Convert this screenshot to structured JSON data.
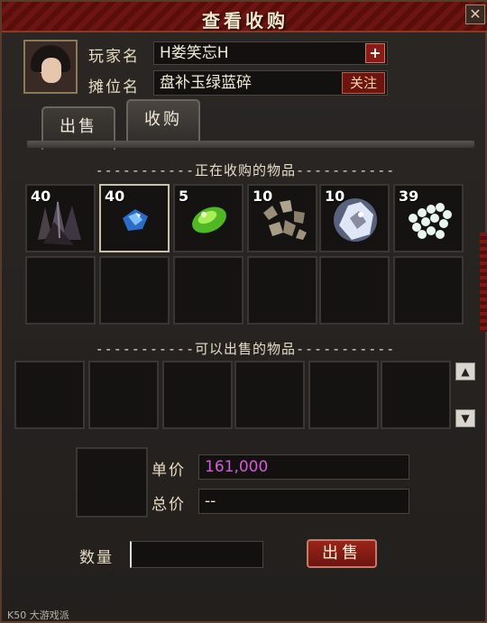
{
  "window": {
    "title": "查看收购",
    "close_glyph": "✕"
  },
  "player": {
    "player_label": "玩家名",
    "player_name": "H娄笑忘H",
    "add_glyph": "+",
    "stall_label": "摊位名",
    "stall_name": "盘补玉绿蓝碎",
    "follow_label": "关注"
  },
  "tabs": [
    {
      "label": "出售",
      "active": false
    },
    {
      "label": "收购",
      "active": true
    }
  ],
  "buying": {
    "header": "-----------正在收购的物品-----------",
    "items": [
      {
        "count": "40",
        "icon": "dark-ore-icon"
      },
      {
        "count": "40",
        "icon": "blue-gem-icon",
        "selected": true
      },
      {
        "count": "5",
        "icon": "green-jade-icon"
      },
      {
        "count": "10",
        "icon": "stone-shards-icon"
      },
      {
        "count": "10",
        "icon": "white-crystal-icon"
      },
      {
        "count": "39",
        "icon": "white-pearls-icon"
      }
    ]
  },
  "selling": {
    "header": "-----------可以出售的物品-----------",
    "scroll_up": "▲",
    "scroll_down": "▼"
  },
  "trade": {
    "unit_price_label": "单价",
    "unit_price": "161,000",
    "total_label": "总价",
    "total": "--",
    "quantity_label": "数量",
    "quantity": "",
    "sell_label": "出售"
  },
  "watermark": "K50 大游戏派"
}
